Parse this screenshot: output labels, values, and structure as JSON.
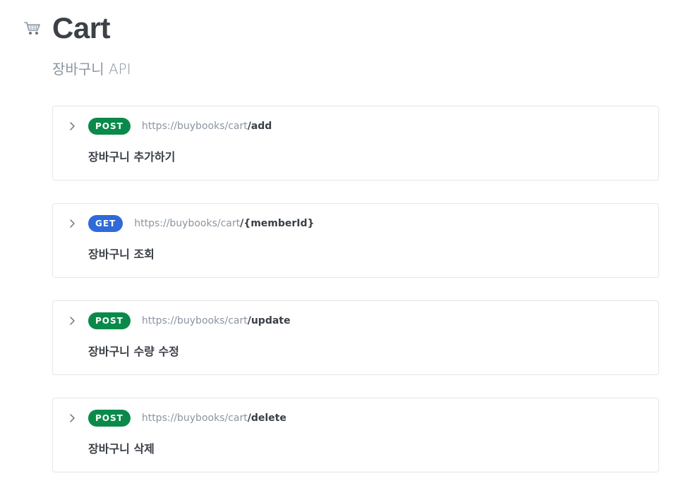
{
  "header": {
    "icon": "shopping-cart-icon",
    "title": "Cart",
    "subtitle": "장바구니 API"
  },
  "colors": {
    "post": "#0a8a4a",
    "get": "#2f6ad8"
  },
  "endpoints": [
    {
      "method": "POST",
      "base_url": "https://buybooks/cart",
      "path": "/add",
      "description": "장바구니 추가하기"
    },
    {
      "method": "GET",
      "base_url": "https://buybooks/cart",
      "path": "/{memberId}",
      "description": "장바구니 조회"
    },
    {
      "method": "POST",
      "base_url": "https://buybooks/cart",
      "path": "/update",
      "description": "장바구니 수량 수정"
    },
    {
      "method": "POST",
      "base_url": "https://buybooks/cart",
      "path": "/delete",
      "description": "장바구니 삭제"
    }
  ]
}
